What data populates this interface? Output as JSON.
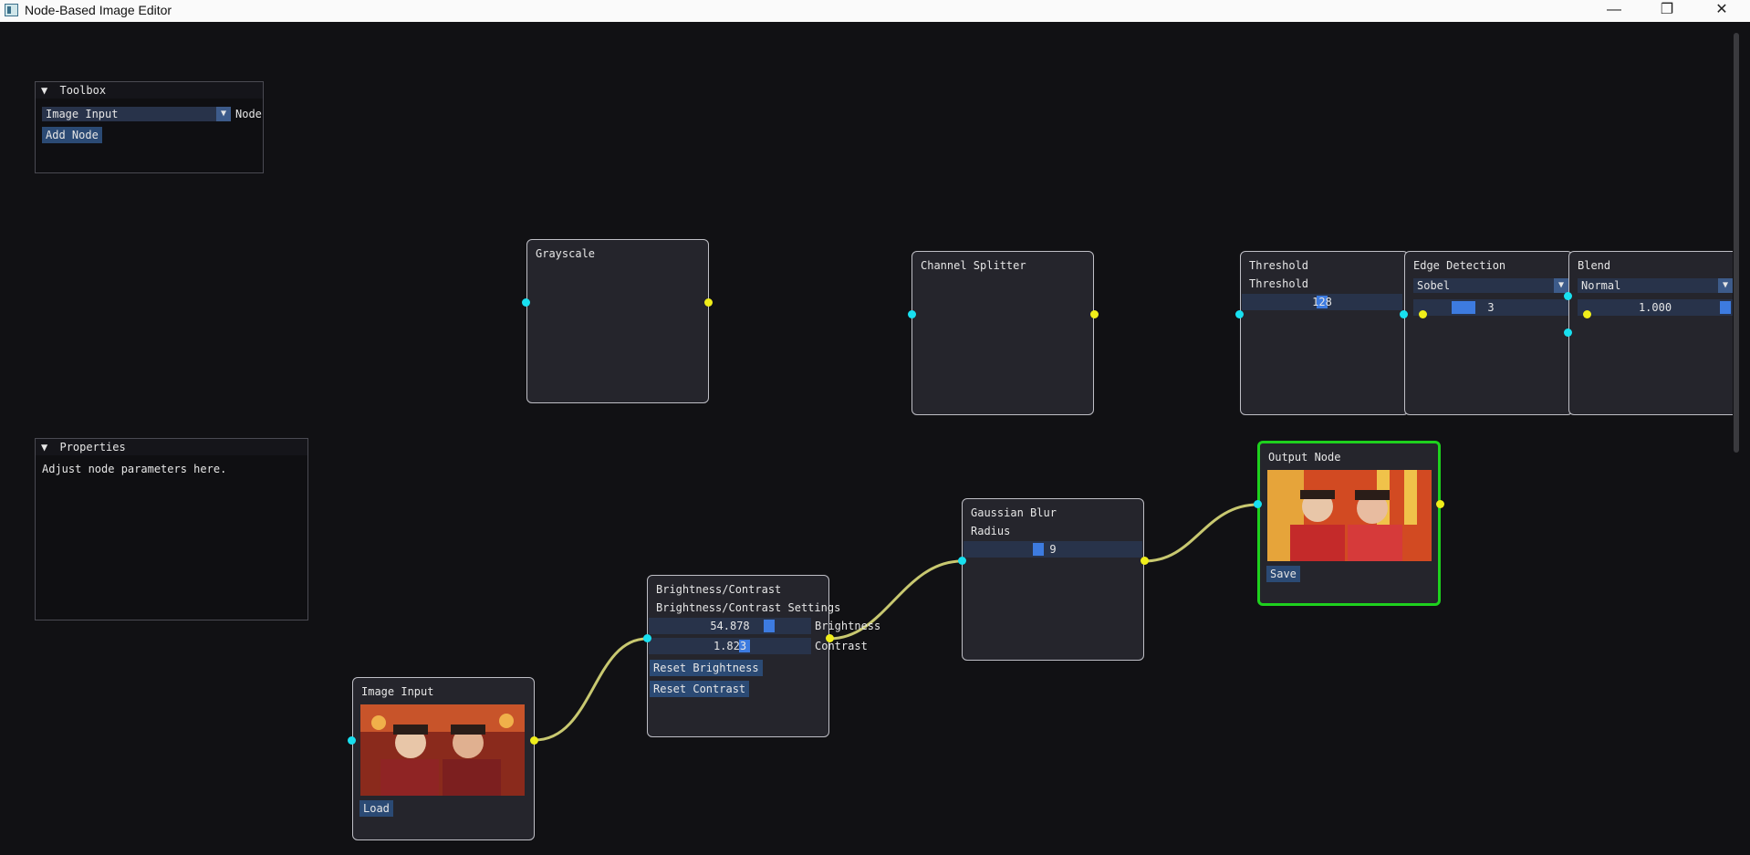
{
  "window": {
    "title": "Node-Based Image Editor",
    "minimize": "—",
    "restore": "❐",
    "close": "✕"
  },
  "toolbox": {
    "title": "Toolbox",
    "collapse_glyph": "▼",
    "node_type_value": "Image Input",
    "node_type_label": "Node",
    "add_button": "Add Node"
  },
  "properties": {
    "title": "Properties",
    "collapse_glyph": "▼",
    "hint": "Adjust node parameters here."
  },
  "nodes": {
    "grayscale": {
      "title": "Grayscale"
    },
    "channel_splitter": {
      "title": "Channel Splitter"
    },
    "threshold": {
      "title": "Threshold",
      "param_label": "Threshold",
      "value": "128"
    },
    "edge_detection": {
      "title": "Edge Detection",
      "method": "Sobel",
      "kernel_value": "3"
    },
    "blend": {
      "title": "Blend",
      "mode": "Normal",
      "opacity_value": "1.000"
    },
    "output": {
      "title": "Output Node",
      "save_button": "Save"
    },
    "gaussian_blur": {
      "title": "Gaussian Blur",
      "param_label": "Radius",
      "value": "9"
    },
    "brightness_contrast": {
      "title": "Brightness/Contrast",
      "settings_label": "Brightness/Contrast Settings",
      "brightness_value": "54.878",
      "brightness_label": "Brightness",
      "contrast_value": "1.823",
      "contrast_label": "Contrast",
      "reset_brightness": "Reset Brightness",
      "reset_contrast": "Reset Contrast"
    },
    "image_input": {
      "title": "Image Input",
      "load_button": "Load"
    }
  },
  "colors": {
    "input_pin": "#18e0f0",
    "output_pin": "#f0ee1a",
    "link": "#c8c870",
    "selected_border": "#1ed11e",
    "accent": "#3d7be0"
  }
}
